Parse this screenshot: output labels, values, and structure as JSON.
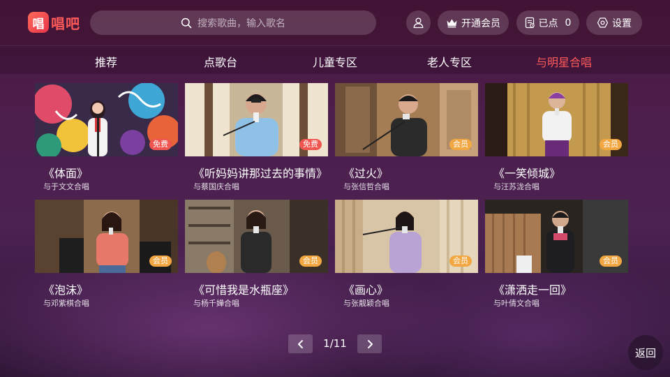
{
  "app": {
    "logo_glyph": "唱",
    "name": "唱吧",
    "brand_color": "#ff5a5a"
  },
  "search": {
    "placeholder": "搜索歌曲，输入歌名"
  },
  "header": {
    "vip_label": "开通会员",
    "queue_label": "已点",
    "queue_count": "0",
    "settings_label": "设置"
  },
  "tabs": [
    {
      "label": "推荐",
      "active": false
    },
    {
      "label": "点歌台",
      "active": false
    },
    {
      "label": "儿童专区",
      "active": false
    },
    {
      "label": "老人专区",
      "active": false
    },
    {
      "label": "与明星合唱",
      "active": true
    }
  ],
  "songs": [
    {
      "title": "《体面》",
      "partner": "与于文文合唱",
      "badge": "免费",
      "badge_type": "free"
    },
    {
      "title": "《听妈妈讲那过去的事情》",
      "partner": "与蔡国庆合唱",
      "badge": "免费",
      "badge_type": "free"
    },
    {
      "title": "《过火》",
      "partner": "与张信哲合唱",
      "badge": "会员",
      "badge_type": "vip"
    },
    {
      "title": "《一笑倾城》",
      "partner": "与汪苏泷合唱",
      "badge": "会员",
      "badge_type": "vip"
    },
    {
      "title": "《泡沫》",
      "partner": "与邓紫棋合唱",
      "badge": "会员",
      "badge_type": "vip"
    },
    {
      "title": "《可惜我是水瓶座》",
      "partner": "与杨千嬅合唱",
      "badge": "会员",
      "badge_type": "vip"
    },
    {
      "title": "《画心》",
      "partner": "与张靓颖合唱",
      "badge": "会员",
      "badge_type": "vip"
    },
    {
      "title": "《潇洒走一回》",
      "partner": "与叶倩文合唱",
      "badge": "会员",
      "badge_type": "vip"
    }
  ],
  "pager": {
    "current": "1/11"
  },
  "back_label": "返回"
}
